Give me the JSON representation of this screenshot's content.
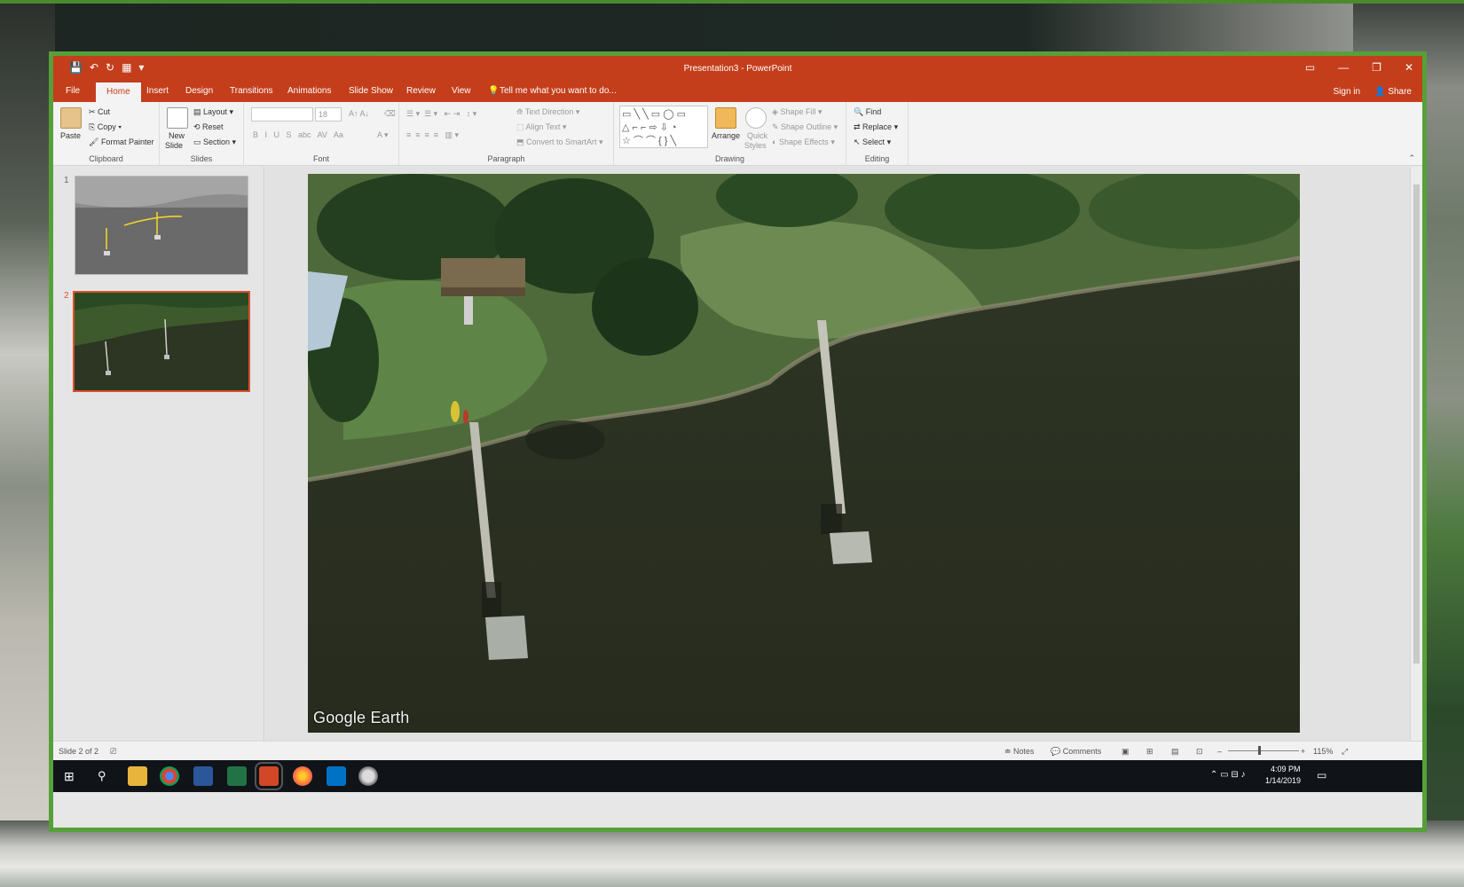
{
  "window": {
    "title": "Presentation3 - PowerPoint"
  },
  "tabs": [
    "File",
    "Home",
    "Insert",
    "Design",
    "Transitions",
    "Animations",
    "Slide Show",
    "Review",
    "View"
  ],
  "tell_me": "Tell me what you want to do...",
  "account": {
    "sign_in": "Sign in",
    "share": "Share"
  },
  "ribbon": {
    "clipboard": {
      "label": "Clipboard",
      "paste": "Paste",
      "cut": "Cut",
      "copy": "Copy",
      "format_painter": "Format Painter"
    },
    "slides": {
      "label": "Slides",
      "new_slide_1": "New",
      "new_slide_2": "Slide",
      "layout": "Layout",
      "reset": "Reset",
      "section": "Section"
    },
    "font": {
      "label": "Font",
      "size": "18"
    },
    "paragraph": {
      "label": "Paragraph",
      "text_direction": "Text Direction",
      "align_text": "Align Text",
      "convert": "Convert to SmartArt"
    },
    "drawing": {
      "label": "Drawing",
      "arrange": "Arrange",
      "quick_styles_1": "Quick",
      "quick_styles_2": "Styles",
      "shape_fill": "Shape Fill",
      "shape_outline": "Shape Outline",
      "shape_effects": "Shape Effects"
    },
    "editing": {
      "label": "Editing",
      "find": "Find",
      "replace": "Replace",
      "select": "Select"
    }
  },
  "thumbnails": [
    {
      "number": "1"
    },
    {
      "number": "2"
    }
  ],
  "slide": {
    "watermark": "Google Earth"
  },
  "status": {
    "slide_info": "Slide 2 of 2",
    "notes": "Notes",
    "comments": "Comments",
    "zoom": "115%"
  },
  "taskbar": {
    "time": "4:09 PM",
    "date": "1/14/2019"
  },
  "colors": {
    "titlebar": "#c43e1c",
    "window_border": "#57a039",
    "selected_thumb": "#d8512d"
  }
}
